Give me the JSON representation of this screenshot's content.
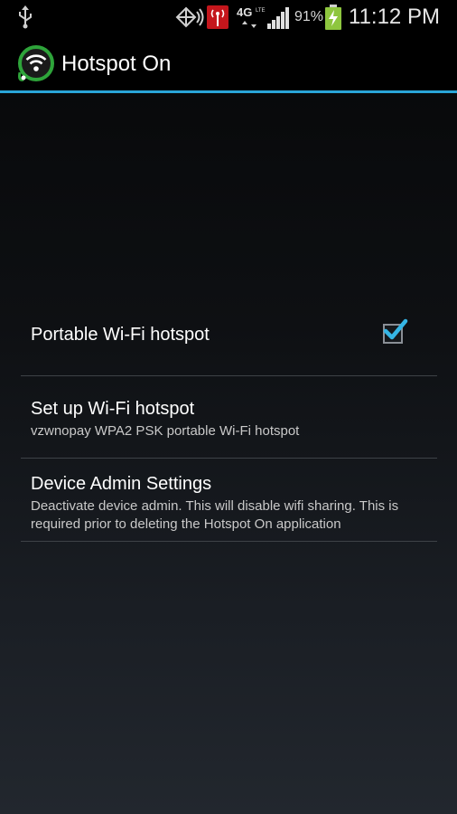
{
  "status_bar": {
    "battery_percent": "91%",
    "time": "11:12 PM",
    "network_label": "4G",
    "icons": [
      "usb-icon",
      "sync-icon",
      "hotspot-icon",
      "network-4g-icon",
      "signal-icon",
      "battery-charging-icon"
    ]
  },
  "action_bar": {
    "title": "Hotspot On",
    "logo": "hotspot-on-logo"
  },
  "preferences": [
    {
      "title": "Portable Wi-Fi hotspot",
      "checked": true
    },
    {
      "title": "Set up Wi-Fi hotspot",
      "summary": "vzwnopay WPA2 PSK portable Wi-Fi hotspot"
    },
    {
      "title": "Device Admin Settings",
      "summary": "Deactivate device admin. This will disable wifi sharing. This is required prior to deleting the Hotspot On application"
    }
  ],
  "colors": {
    "accent": "#2aa6d8",
    "hotspot_badge": "#c4161c"
  }
}
